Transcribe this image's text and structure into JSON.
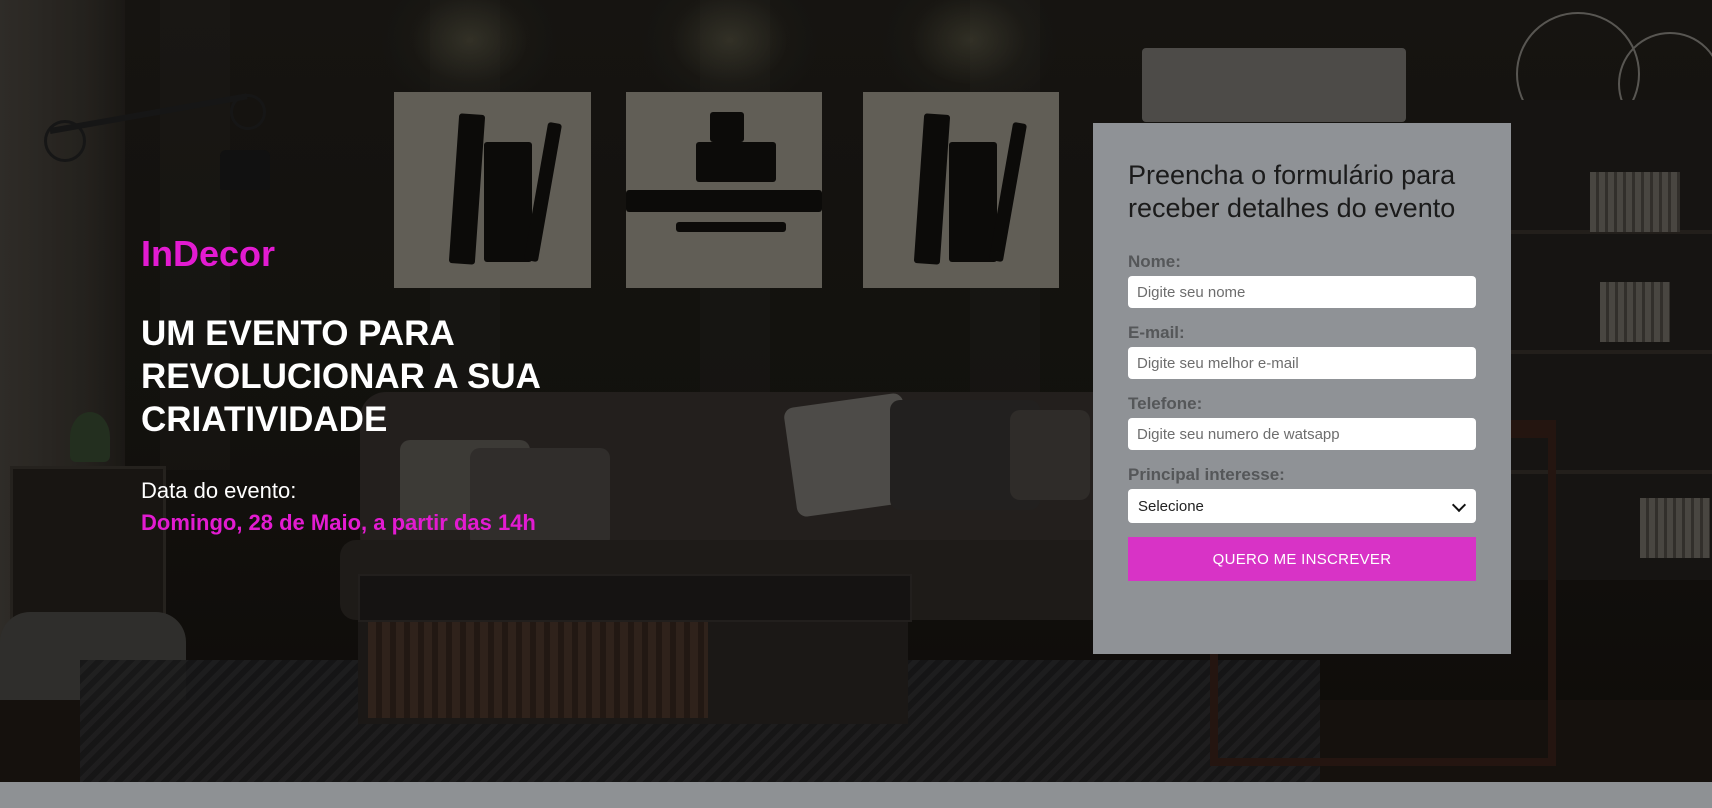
{
  "hero": {
    "brand": "InDecor",
    "headline": "UM EVENTO PARA REVOLUCIONAR A SUA CRIATIVIDADE",
    "date_label": "Data do evento:",
    "date_value": "Domingo, 28 de Maio, a partir das 14h",
    "background_image": "dark-living-room-photo"
  },
  "form": {
    "title": "Preencha o formulário para receber detalhes do evento",
    "fields": [
      {
        "label": "Nome:",
        "placeholder": "Digite seu nome",
        "value": ""
      },
      {
        "label": "E-mail:",
        "placeholder": "Digite seu melhor e-mail",
        "value": ""
      },
      {
        "label": "Telefone:",
        "placeholder": "Digite seu numero de watsapp",
        "value": ""
      }
    ],
    "interest": {
      "label": "Principal interesse:",
      "selected": "Selecione"
    },
    "submit_label": "Quero me inscrever"
  },
  "colors": {
    "accent": "#e21bd1",
    "button": "#d833c6",
    "panel": "#8f9296",
    "footer_band": "#8e9194"
  }
}
